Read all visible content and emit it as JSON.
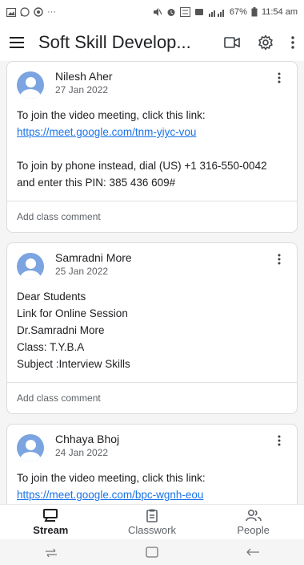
{
  "status": {
    "left_icons": [
      "gallery-icon",
      "whatsapp-icon",
      "chrome-icon",
      "more-dots"
    ],
    "more": "···",
    "battery": "67%",
    "time": "11:54 am"
  },
  "app_bar": {
    "title": "Soft Skill Develop..."
  },
  "posts": [
    {
      "author": "Nilesh Aher",
      "date": "27 Jan 2022",
      "lines": [
        {
          "text": "To join the video meeting, click this link:",
          "type": "text"
        },
        {
          "text": "https://meet.google.com/tnm-yiyc-vou",
          "type": "link"
        },
        {
          "text": "",
          "type": "gap"
        },
        {
          "text": "To join by phone instead, dial (US) +1 316-550-0042",
          "type": "text"
        },
        {
          "text": "and enter this PIN: 385 436 609#",
          "type": "text"
        }
      ],
      "comment_placeholder": "Add class comment"
    },
    {
      "author": "Samradni More",
      "date": "25 Jan 2022",
      "lines": [
        {
          "text": "Dear Students",
          "type": "text"
        },
        {
          "text": "Link for Online Session",
          "type": "text"
        },
        {
          "text": "Dr.Samradni More",
          "type": "text"
        },
        {
          "text": "Class: T.Y.B.A",
          "type": "text"
        },
        {
          "text": "Subject :Interview Skills",
          "type": "text"
        }
      ],
      "comment_placeholder": "Add class comment"
    },
    {
      "author": "Chhaya Bhoj",
      "date": "24 Jan 2022",
      "lines": [
        {
          "text": "To join the video meeting, click this link:",
          "type": "text"
        },
        {
          "text": "https://meet.google.com/bpc-wgnh-eou",
          "type": "link"
        }
      ],
      "comment_placeholder": ""
    }
  ],
  "bottom_nav": [
    {
      "label": "Stream",
      "icon": "stream-icon",
      "active": true
    },
    {
      "label": "Classwork",
      "icon": "classwork-icon",
      "active": false
    },
    {
      "label": "People",
      "icon": "people-icon",
      "active": false
    }
  ],
  "colors": {
    "link": "#1a73e8",
    "avatar": "#7ba4e0",
    "background": "#f5f5f5"
  }
}
